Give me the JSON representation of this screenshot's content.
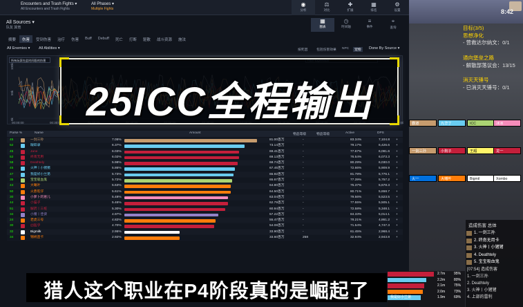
{
  "topbar": {
    "encounter": "Encounters and Trash Fights",
    "encounter_sub": "All Encounters and Trash Fights",
    "phases": "All Phases",
    "phases_sub": "Multiple Fights",
    "icons": [
      {
        "icon": "eye-icon",
        "label": "分析",
        "active": true
      },
      {
        "icon": "scale-icon",
        "label": "对比",
        "active": false
      },
      {
        "icon": "puzzle-icon",
        "label": "扩展",
        "active": false
      },
      {
        "icon": "grid-icon",
        "label": "排名",
        "active": false
      },
      {
        "icon": "settings-icon",
        "label": "设置",
        "active": false
      }
    ]
  },
  "sources": {
    "label": "All Sources",
    "sub": "队友 其他"
  },
  "view_icons": [
    {
      "icon": "table-icon",
      "label": "图表",
      "active": true
    },
    {
      "icon": "clock-icon",
      "label": "时间轴",
      "active": false
    },
    {
      "icon": "list-icon",
      "label": "事件",
      "active": false
    },
    {
      "icon": "pin-icon",
      "label": "查询",
      "active": false
    }
  ],
  "tabs": [
    "摘要",
    "伤害",
    "受到伤害",
    "治疗",
    "伤害",
    "Buff",
    "Debuff",
    "死亡",
    "打断",
    "驱散",
    "战斗资源",
    "施法"
  ],
  "active_tab": 1,
  "subrow": {
    "enemies": "All Enemies",
    "abilities": "All Abilities",
    "right": [
      "按死因",
      "包括伤害效果",
      "NPC",
      "宠物"
    ],
    "right_selected": 3,
    "done_by": "Done By Source"
  },
  "chart_panel": {
    "selector": "所有玩家在此时间段的伤害",
    "filter": "Filter Expression",
    "time_ticks": [
      "00:00:00",
      "00:30:00",
      "01:00:00",
      "01:30:00",
      "02:00:00",
      "02:30:00",
      "03:00:00",
      "03:30:00",
      "04:00:00",
      "04:30:00",
      "05:00:00"
    ],
    "y_ticks": [
      "0k",
      "50k",
      "100k"
    ]
  },
  "overlay_title": "25ICC全程输出",
  "table": {
    "headers": [
      "Parse %",
      "Name",
      "Amount",
      "物品等级",
      "物品等级",
      "Active",
      "DPS"
    ],
    "rows": [
      {
        "rank": "45",
        "name": "一剑三孙",
        "pct": "7.05%",
        "amount": "81.00百万",
        "ilvl": "-",
        "active": "83.34%",
        "dps": "7,104.8",
        "color": "#c79c6e",
        "bar": 0.96
      },
      {
        "rank": "52",
        "name": "眼碎录",
        "pct": "6.37%",
        "amount": "73.14百万",
        "ilvl": "-",
        "active": "79.17%",
        "dps": "6,426.6",
        "color": "#69ccf0",
        "bar": 0.87
      },
      {
        "rank": "45",
        "name": "Jane",
        "pct": "6.03%",
        "amount": "69.41百万",
        "ilvl": "-",
        "active": "77.67%",
        "dps": "6,081.6",
        "color": "#c41f3b",
        "bar": 0.83
      },
      {
        "rank": "52",
        "name": "终南无用",
        "pct": "6.02%",
        "amount": "69.13百万",
        "ilvl": "-",
        "active": "76.54%",
        "dps": "6,073.3",
        "color": "#c41f3b",
        "bar": 0.83
      },
      {
        "rank": "58",
        "name": "Deathtely",
        "pct": "5.98%",
        "amount": "68.74百万",
        "ilvl": "-",
        "active": "80.29%",
        "dps": "6,030.0",
        "color": "#c41f3b",
        "bar": 0.82
      },
      {
        "rank": "45",
        "name": "火神丨小猪猪",
        "pct": "5.86%",
        "amount": "67.45百万",
        "ilvl": "-",
        "active": "72.66%",
        "dps": "5,909.9",
        "color": "#69ccf0",
        "bar": 0.8
      },
      {
        "rank": "47",
        "name": "我是好小兰弟",
        "pct": "5.73%",
        "amount": "65.92百万",
        "ilvl": "-",
        "active": "81.78%",
        "dps": "5,776.1",
        "color": "#69ccf0",
        "bar": 0.79
      },
      {
        "rank": "35",
        "name": "宝宝吸血鬼",
        "pct": "5.72%",
        "amount": "65.67百万",
        "ilvl": "-",
        "active": "77.39%",
        "dps": "5,757.2",
        "color": "#abd473",
        "bar": 0.78
      },
      {
        "rank": "44",
        "name": "大曦叶",
        "pct": "5.63%",
        "amount": "64.80百万",
        "ilvl": "-",
        "active": "75.37%",
        "dps": "5,678.3",
        "color": "#ff7d0a",
        "bar": 0.77
      },
      {
        "rank": "50",
        "name": "火鼎旺仔",
        "pct": "5.61%",
        "amount": "64.50百万",
        "ilvl": "-",
        "active": "80.71%",
        "dps": "5,658.7",
        "color": "#ff7d0a",
        "bar": 0.77
      },
      {
        "rank": "30",
        "name": "小萝卜的崽儿",
        "pct": "5.48%",
        "amount": "63.04百万",
        "ilvl": "-",
        "active": "79.56%",
        "dps": "5,523.5",
        "color": "#f58cba",
        "bar": 0.75
      },
      {
        "rank": "44",
        "name": "小猫子",
        "pct": "5.46%",
        "amount": "62.79百万",
        "ilvl": "-",
        "active": "77.55%",
        "dps": "5,505.1",
        "color": "#c41f3b",
        "bar": 0.75
      },
      {
        "rank": "51",
        "name": "解药丨三桩",
        "pct": "5.30%",
        "amount": "60.94百万",
        "ilvl": "-",
        "active": "72.58%",
        "dps": "5,348.1",
        "color": "#c41f3b",
        "bar": 0.73
      },
      {
        "rank": "34",
        "name": "小猪丨佳侠",
        "pct": "4.97%",
        "amount": "57.22百万",
        "ilvl": "-",
        "active": "84.33%",
        "dps": "5,014.1",
        "color": "#9482c9",
        "bar": 0.68
      },
      {
        "rank": "24",
        "name": "老虎三号",
        "pct": "4.82%",
        "amount": "55.47百万",
        "ilvl": "-",
        "active": "78.21%",
        "dps": "4,861.2",
        "color": "#ff7d0a",
        "bar": 0.66
      },
      {
        "rank": "30",
        "name": "凶猛乎",
        "pct": "4.70%",
        "amount": "54.08百万",
        "ilvl": "-",
        "active": "71.54%",
        "dps": "4,747.3",
        "color": "#c41f3b",
        "bar": 0.65
      },
      {
        "rank": "32",
        "name": "Bigmilk",
        "pct": "2.95%",
        "amount": "33.90百万",
        "ilvl": "-",
        "active": "61.45%",
        "dps": "2,968.4",
        "color": "#ffffff",
        "bar": 0.4
      },
      {
        "rank": "34",
        "name": "锦绣歪卡",
        "pct": "2.92%",
        "amount": "33.60百万",
        "ilvl": "258",
        "active": "32.94%",
        "dps": "2,943.8",
        "color": "#ff7d0a",
        "bar": 0.4
      }
    ]
  },
  "subtitle": "猎人这个职业在P4阶段真的是崛起了",
  "game": {
    "clock": "8:42",
    "quest": [
      {
        "t": "目标(3/5)",
        "h": true
      },
      {
        "t": "思想净化",
        "h": true
      },
      {
        "t": "- 营救达尔纳文：0/1",
        "h": false
      },
      {
        "t": "",
        "h": false
      },
      {
        "t": "通向堡垒之路",
        "h": true
      },
      {
        "t": "- 解散部落议会：13/15",
        "h": false
      },
      {
        "t": "",
        "h": false
      },
      {
        "t": "消灭天锤号",
        "h": true
      },
      {
        "t": "- 已消灭天锤号：0/1",
        "h": false
      }
    ],
    "raid_frames": [
      {
        "name": "霸道",
        "color": "#c79c6e"
      },
      {
        "name": "九华丁",
        "color": "#69ccf0"
      },
      {
        "name": "ICC",
        "color": "#abd473"
      },
      {
        "name": "冰冰",
        "color": "#f58cba"
      },
      {
        "name": "一剑三孙",
        "color": "#c79c6e"
      },
      {
        "name": "小狗子",
        "color": "#c41f3b"
      },
      {
        "name": "王超",
        "color": "#fff569"
      },
      {
        "name": "龙一",
        "color": "#c41f3b"
      },
      {
        "name": "火一",
        "color": "#0070de"
      },
      {
        "name": "大曦叶",
        "color": "#ff7d0a"
      },
      {
        "name": "Bigmil",
        "color": "#ffffff"
      },
      {
        "name": "Xombo",
        "color": "#ffffff"
      }
    ],
    "damage_panel": {
      "title": "造成伤害 总体",
      "entries": [
        "1. 一剑三孙",
        "2. 终南无用卡",
        "3. 火神丨小猪猪",
        "4. Deathtely",
        "5. 宝宝吸血鬼"
      ],
      "log_time": "[07:54] 造成伤害",
      "log_entries": [
        "1. 一剑三孙",
        "2. Deathtely",
        "3. 火神丨小猪猪",
        "4. 上部的雷利"
      ]
    },
    "stat_box": [
      {
        "name": "",
        "v1": "2.7m",
        "v2": "95%",
        "color": "#c41f3b"
      },
      {
        "name": "",
        "v1": "2.2m",
        "v2": "80%",
        "color": "#69ccf0"
      },
      {
        "name": "",
        "v1": "2.1m",
        "v2": "75%",
        "color": "#c41f3b"
      },
      {
        "name": "",
        "v1": "2.0m",
        "v2": "73%",
        "color": "#ff7d0a"
      },
      {
        "name": "我是好小兰弟",
        "v1": "1.9m",
        "v2": "69%",
        "color": "#69ccf0"
      }
    ]
  }
}
